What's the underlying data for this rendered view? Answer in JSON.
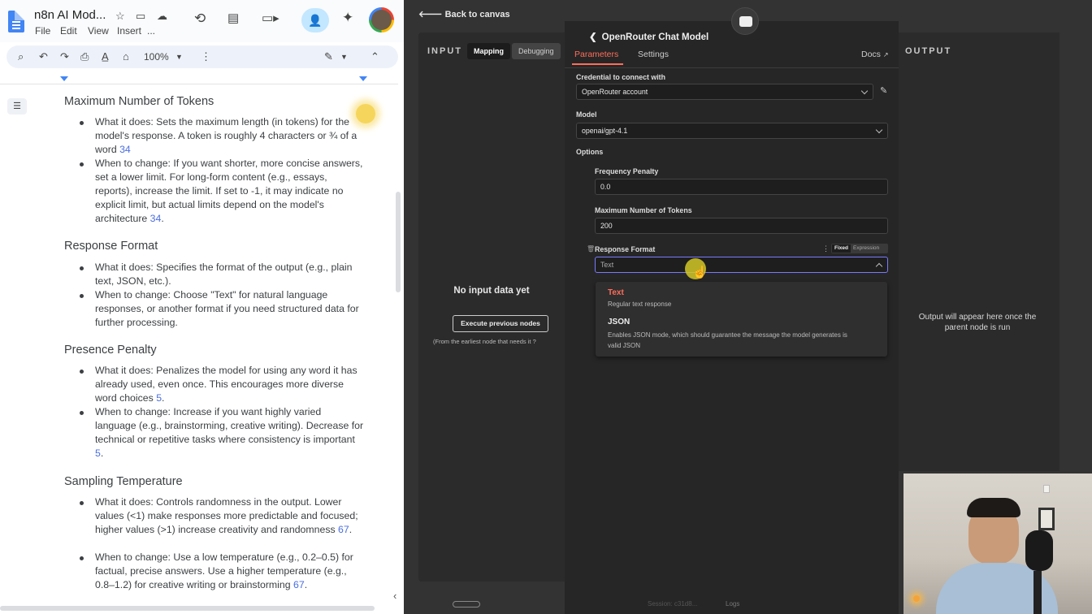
{
  "docs": {
    "title": "n8n AI Mod...",
    "menu": [
      "File",
      "Edit",
      "View",
      "Insert",
      "..."
    ],
    "zoom": "100%",
    "sections": [
      {
        "heading": "Maximum Number of Tokens",
        "bullets": [
          {
            "text": "What it does: Sets the maximum length (in tokens) for the model's response. A token is roughly 4 characters or ¾ of a word",
            "ref": "34"
          },
          {
            "text": "When to change: If you want shorter, more concise answers, set a lower limit. For long-form content (e.g., essays, reports), increase the limit. If set to -1, it may indicate no explicit limit, but actual limits depend on the model's architecture",
            "ref": "34"
          }
        ]
      },
      {
        "heading": "Response Format",
        "bullets": [
          {
            "text": "What it does: Specifies the format of the output (e.g., plain text, JSON, etc.).",
            "ref": ""
          },
          {
            "text": "When to change: Choose \"Text\" for natural language responses, or another format if you need structured data for further processing.",
            "ref": ""
          }
        ]
      },
      {
        "heading": "Presence Penalty",
        "bullets": [
          {
            "text": "What it does: Penalizes the model for using any word it has already used, even once. This encourages more diverse word choices",
            "ref": "5"
          },
          {
            "text": "When to change: Increase if you want highly varied language (e.g., brainstorming, creative writing). Decrease for technical or repetitive tasks where consistency is important",
            "ref": "5"
          }
        ]
      },
      {
        "heading": "Sampling Temperature",
        "bullets": [
          {
            "text": "What it does: Controls randomness in the output. Lower values (<1) make responses more predictable and focused; higher values (>1) increase creativity and randomness",
            "ref": "67"
          },
          {
            "text": "When to change: Use a low temperature (e.g., 0.2–0.5) for factual, precise answers. Use a higher temperature (e.g., 0.8–1.2) for creative writing or brainstorming",
            "ref": "67"
          }
        ]
      }
    ]
  },
  "n8n": {
    "back_label": "Back to canvas",
    "input_label": "INPUT",
    "output_label": "OUTPUT",
    "input_tabs": [
      "Mapping",
      "Debugging"
    ],
    "no_input": "No input data yet",
    "execute_button": "Execute previous nodes",
    "execute_hint": "(From the earliest node that needs it",
    "output_hint": "Output will appear here once the parent node is run",
    "node_title": "OpenRouter Chat Model",
    "tabs": {
      "parameters": "Parameters",
      "settings": "Settings",
      "docs": "Docs"
    },
    "credential_label": "Credential to connect with",
    "credential_value": "OpenRouter account",
    "model_label": "Model",
    "model_value": "openai/gpt-4.1",
    "options_label": "Options",
    "freq_label": "Frequency Penalty",
    "freq_value": "0.0",
    "maxtok_label": "Maximum Number of Tokens",
    "maxtok_value": "200",
    "respfmt_label": "Response Format",
    "toggle_fixed": "Fixed",
    "toggle_expression": "Expression",
    "respfmt_value": "Text",
    "dropdown": [
      {
        "title": "Text",
        "desc": "Regular text response"
      },
      {
        "title": "JSON",
        "desc": "Enables JSON mode, which should guarantee the message the model generates is valid JSON"
      }
    ],
    "footer_session": "Session: c31d8...",
    "footer_logs": "Logs",
    "accent": "#ff6d5a"
  }
}
